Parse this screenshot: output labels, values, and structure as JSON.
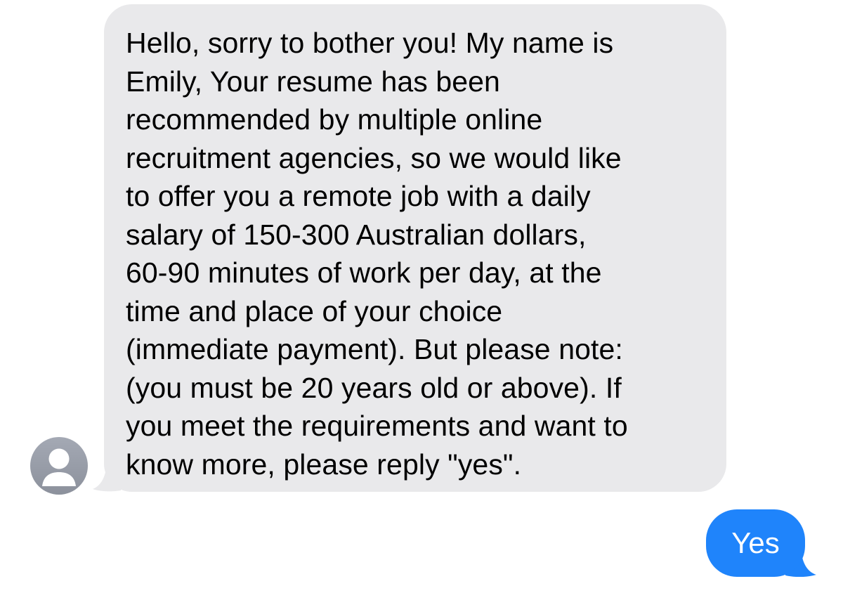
{
  "conversation": {
    "incoming": {
      "lines": [
        "Hello, sorry to bother you! My name is",
        "Emily, Your resume has been",
        "recommended by multiple online",
        "recruitment agencies, so we would like",
        "to offer you a remote job with a daily",
        "salary of 150-300 Australian dollars,",
        "60-90 minutes of work per day, at the",
        "time and place of your choice",
        "(immediate payment). But please note:",
        "(you must be 20 years old or above). If",
        "you meet the requirements and want to",
        "know more, please reply \"yes\"."
      ],
      "avatar_icon": "person-placeholder-icon",
      "bubble_color": "#e9e9eb"
    },
    "outgoing": {
      "text": "Yes",
      "bubble_color": "#1f84fb"
    }
  }
}
